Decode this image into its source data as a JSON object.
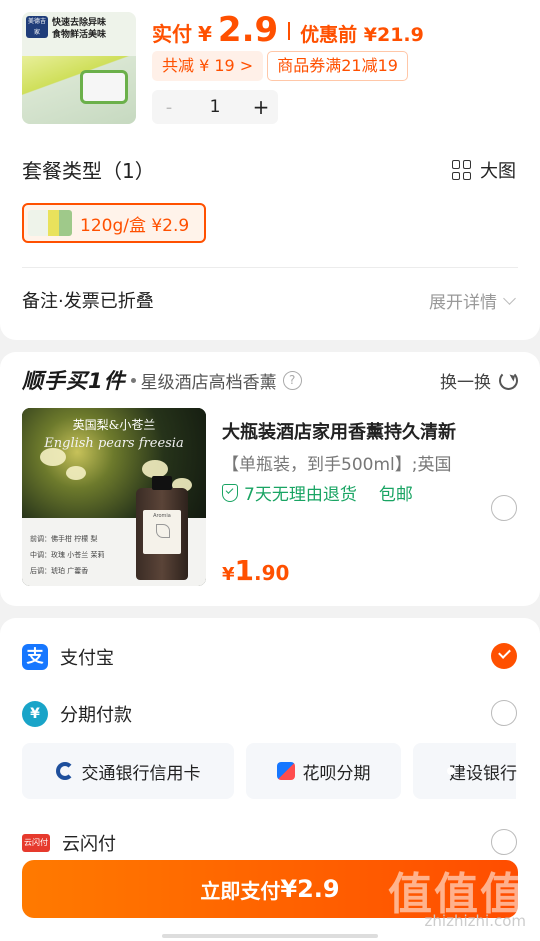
{
  "product": {
    "thumb_text_1": "美德吉家",
    "thumb_text_2": "快速去除异味",
    "thumb_text_3": "食物鲜活美味",
    "pay_label": "实付",
    "currency": "¥",
    "pay_amount": "2.9",
    "before_label": "优惠前 ¥21.9",
    "discount_tag": "共减 ¥ 19 >",
    "coupon_tag": "商品券满21减19",
    "qty_minus": "-",
    "qty": "1",
    "qty_plus": "+"
  },
  "combo": {
    "title": "套餐类型（1）",
    "big_view": "大图",
    "option": "120g/盒  ¥2.9"
  },
  "remark": {
    "label": "备注·发票已折叠",
    "expand": "展开详情"
  },
  "addon": {
    "brand": "顺手买1件",
    "subtitle": "星级酒店高档香薰",
    "help": "?",
    "refresh": "换一换",
    "image_caption_cn": "英国梨&小苍兰",
    "image_caption_en": "English pears freesia",
    "note_top": "前调：佛手柑  柠檬  梨",
    "note_mid": "中调：玫瑰  小苍兰  茉莉",
    "note_base": "后调：琥珀  广藿香",
    "bottle_label": "Aromia",
    "title": "大瓶装酒店家用香薰持久清新",
    "desc": "【单瓶装，到手500ml】;英国",
    "guarantee": "7天无理由退货",
    "shipping": "包邮",
    "price_symbol": "¥",
    "price_int": "1",
    "price_dec": ".90"
  },
  "payment": {
    "methods": [
      {
        "label": "支付宝",
        "icon": "alipay-icon",
        "selected": true
      },
      {
        "label": "分期付款",
        "icon": "installment-icon",
        "selected": false
      },
      {
        "label": "云闪付",
        "icon": "unionpay-icon",
        "selected": false
      }
    ],
    "installment_options": [
      "交通银行信用卡",
      "花呗分期",
      "建设银行"
    ],
    "unionpay_icon_text": "云闪付",
    "pay_button": "立即支付",
    "pay_button_amount": "¥2.9"
  },
  "watermark": {
    "main": "值值值",
    "url": "zhizhizhi.com"
  },
  "colors": {
    "accent": "#ff5000",
    "green": "#19a463",
    "alipay": "#1677ff"
  }
}
